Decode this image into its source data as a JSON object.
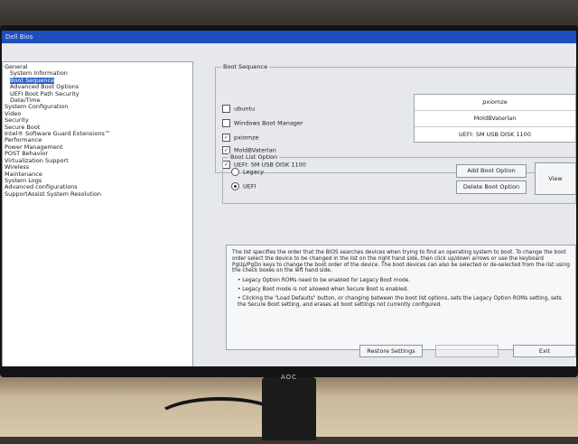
{
  "window": {
    "title": "Dell Bios"
  },
  "tree": {
    "items": [
      {
        "label": "General",
        "level": 0,
        "selected": false
      },
      {
        "label": "System Information",
        "level": 1,
        "selected": false
      },
      {
        "label": "Boot Sequence",
        "level": 1,
        "selected": true
      },
      {
        "label": "Advanced Boot Options",
        "level": 1,
        "selected": false
      },
      {
        "label": "UEFI Boot Path Security",
        "level": 1,
        "selected": false
      },
      {
        "label": "Date/Time",
        "level": 1,
        "selected": false
      },
      {
        "label": "System Configuration",
        "level": 0,
        "selected": false
      },
      {
        "label": "Video",
        "level": 0,
        "selected": false
      },
      {
        "label": "Security",
        "level": 0,
        "selected": false
      },
      {
        "label": "Secure Boot",
        "level": 0,
        "selected": false
      },
      {
        "label": "Intel® Software Guard Extensions™",
        "level": 0,
        "selected": false
      },
      {
        "label": "Performance",
        "level": 0,
        "selected": false
      },
      {
        "label": "Power Management",
        "level": 0,
        "selected": false
      },
      {
        "label": "POST Behavior",
        "level": 0,
        "selected": false
      },
      {
        "label": "Virtualization Support",
        "level": 0,
        "selected": false
      },
      {
        "label": "Wireless",
        "level": 0,
        "selected": false
      },
      {
        "label": "Maintenance",
        "level": 0,
        "selected": false
      },
      {
        "label": "System Logs",
        "level": 0,
        "selected": false
      },
      {
        "label": "Advanced configurations",
        "level": 0,
        "selected": false
      },
      {
        "label": "SupportAssist System Resolution",
        "level": 0,
        "selected": false
      }
    ]
  },
  "boot_sequence": {
    "title": "Boot Sequence",
    "options": [
      {
        "label": "ubuntu",
        "checked": false
      },
      {
        "label": "Windows Boot Manager",
        "checked": false
      },
      {
        "label": "pxiomze",
        "checked": true
      },
      {
        "label": "MoldBVaterlan",
        "checked": true
      },
      {
        "label": "UEFI: SM USB DISK 1100",
        "checked": true
      }
    ],
    "order_list": [
      "pxiomze",
      "MoldBVaterlan",
      "UEFI: SM USB DISK 1100"
    ]
  },
  "boot_list_option": {
    "title": "Boot List Option",
    "legacy_label": "Legacy",
    "uefi_label": "UEFI",
    "selected": "UEFI",
    "add_button": "Add Boot Option",
    "delete_button": "Delete Boot Option",
    "view_button": "View"
  },
  "description": {
    "paragraph": "The list specifies the order that the BIOS searches devices when trying to find an operating system to boot. To change the boot order select the device to be changed in the list on the right hand side, then click up/down arrows or use the keyboard PgUp/PgDn keys to change the boot order of the device. The boot devices can also be selected or de-selected from the list using the check boxes on the left hand side.",
    "bullets": [
      "• Legacy Option ROMs need to be enabled for Legacy Boot mode.",
      "• Legacy Boot mode is not allowed when Secure Boot is enabled.",
      "• Clicking the \"Load Defaults\" button, or changing between the boot list options, sets the Legacy Option ROMs setting, sets the Secure Boot setting, and erases all boot settings not currently configured."
    ]
  },
  "footer": {
    "restore_button": "Restore Settings",
    "apply_button": "",
    "exit_button": "Exit"
  },
  "monitor": {
    "brand": "AOC"
  }
}
